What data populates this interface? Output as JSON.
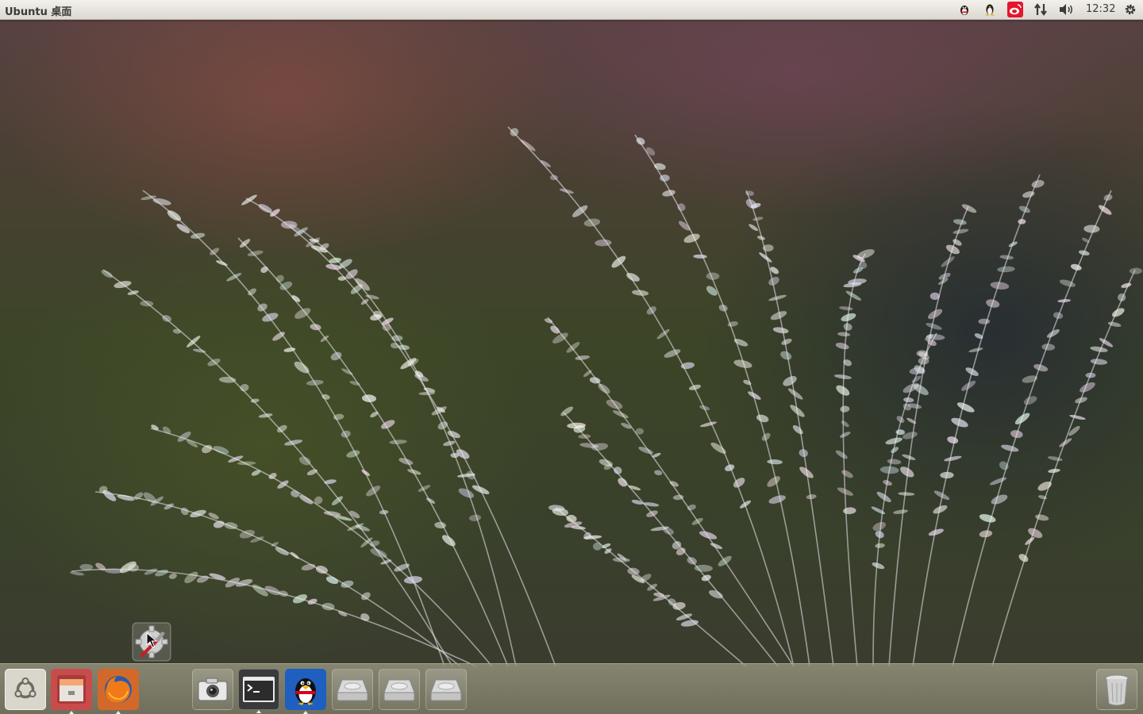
{
  "top_panel": {
    "title": "Ubuntu 桌面",
    "clock": "12:32",
    "indicators": [
      {
        "name": "qq-penguin-icon"
      },
      {
        "name": "linux-tux-icon"
      },
      {
        "name": "weibo-icon"
      },
      {
        "name": "network-transfer-icon"
      },
      {
        "name": "volume-icon"
      },
      {
        "name": "system-gear-icon"
      }
    ]
  },
  "launcher": {
    "items": [
      {
        "name": "ubuntu-dash-icon",
        "running": false
      },
      {
        "name": "file-manager-icon",
        "running": true
      },
      {
        "name": "firefox-icon",
        "running": true
      },
      {
        "name": "screenshot-camera-icon",
        "running": false
      },
      {
        "name": "terminal-icon",
        "running": true
      },
      {
        "name": "qq-client-icon",
        "running": true
      },
      {
        "name": "drive-icon",
        "running": false
      },
      {
        "name": "drive-icon",
        "running": false
      },
      {
        "name": "drive-icon",
        "running": false
      },
      {
        "name": "trash-icon",
        "running": false
      }
    ]
  },
  "dragged_item": {
    "name": "system-settings-icon"
  },
  "colors": {
    "panel": "#dcd9d1",
    "panel_text": "#3c3b37",
    "weibo_red": "#e6162d",
    "firefox_orange": "#e66000",
    "qq_blue": "#1f5fbf"
  }
}
